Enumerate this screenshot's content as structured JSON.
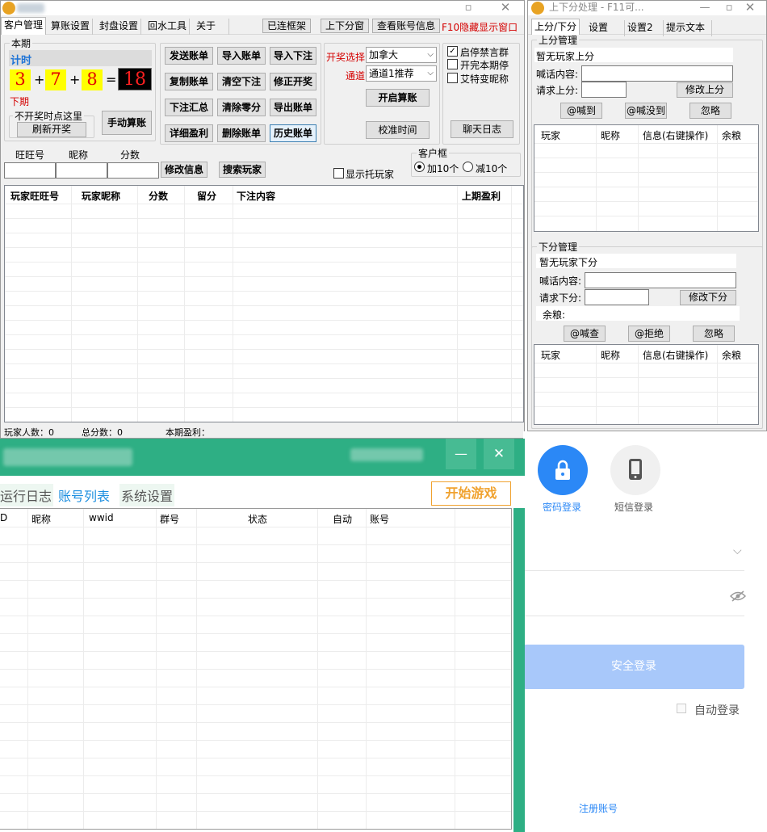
{
  "main": {
    "tabs": [
      "客户管理",
      "算账设置",
      "封盘设置",
      "回水工具",
      "关于"
    ],
    "toolbar": {
      "btn1": "已连框架",
      "btn2": "上下分窗",
      "btn3": "查看账号信息",
      "hint": "F10隐藏显示窗口"
    },
    "period": {
      "legend": "本期",
      "timer_label": "计时",
      "next_label": "下期",
      "digits": [
        "3",
        "7",
        "8"
      ],
      "plus": "+",
      "equals": "=",
      "result": "18",
      "no_draw_hint": "不开奖时点这里",
      "refresh_button": "刷新开奖",
      "manual_button": "手动算账"
    },
    "buttons": {
      "send": "发送账单",
      "import_bill": "导入账单",
      "import_bet": "导入下注",
      "copy": "复制账单",
      "clear_bet": "清空下注",
      "fix_draw": "修正开奖",
      "bet_summary": "下注汇总",
      "clear_zero": "清除零分",
      "export": "导出账单",
      "detail_profit": "详细盈利",
      "delete_bill": "删除账单",
      "history": "历史账单"
    },
    "draw": {
      "select_label": "开奖选择",
      "select_value": "加拿大",
      "channel_label": "通道",
      "channel_value": "通道1推荐",
      "start_button": "开启算账",
      "calibrate_button": "校准时间"
    },
    "options": {
      "ban_group": "启停禁言群",
      "stop_after": "开完本期停",
      "at_nick": "艾特变昵称",
      "chat_log_button": "聊天日志"
    },
    "inputs": {
      "wangwang_label": "旺旺号",
      "nick_label": "昵称",
      "score_label": "分数",
      "modify_button": "修改信息",
      "search_button": "搜索玩家",
      "show_proxy": "显示托玩家"
    },
    "client_box": {
      "legend": "客户框",
      "add": "加10个",
      "sub": "减10个"
    },
    "table": {
      "headers": [
        "玩家旺旺号",
        "玩家昵称",
        "分数",
        "留分",
        "下注内容",
        "上期盈利"
      ]
    },
    "status": {
      "players": "玩家人数：0",
      "total": "总分数：0",
      "profit": "本期盈利："
    }
  },
  "side": {
    "title": "上下分处理 - F11可...",
    "tabs": [
      "上分/下分",
      "设置",
      "设置2",
      "提示文本"
    ],
    "up": {
      "legend": "上分管理",
      "empty": "暂无玩家上分",
      "shout_label": "喊话内容:",
      "request_label": "请求上分:",
      "modify_button": "修改上分",
      "btn_arrived": "@喊到",
      "btn_missing": "@喊没到",
      "btn_ignore": "忽略"
    },
    "up_table": {
      "headers": [
        "玩家",
        "昵称",
        "信息(右键操作)",
        "余粮"
      ]
    },
    "down": {
      "legend": "下分管理",
      "empty": "暂无玩家下分",
      "shout_label": "喊话内容:",
      "request_label": "请求下分:",
      "modify_button": "修改下分",
      "balance_label": "余粮:",
      "btn_check": "@喊查",
      "btn_reject": "@拒绝",
      "btn_ignore": "忽略"
    },
    "down_table": {
      "headers": [
        "玩家",
        "昵称",
        "信息(右键操作)",
        "余粮"
      ]
    }
  },
  "green": {
    "tabs": [
      "运行日志",
      "账号列表",
      "系统设置"
    ],
    "start_button": "开始游戏",
    "table": {
      "headers": [
        "D",
        "昵称",
        "wwid",
        "群号",
        "状态",
        "自动",
        "账号"
      ]
    },
    "minimize": "—",
    "close": "✕"
  },
  "login": {
    "password_login": "密码登录",
    "sms_login": "短信登录",
    "submit": "安全登录",
    "auto_login": "自动登录",
    "register": "注册账号",
    "accent": "#2b88f6",
    "submit_color": "#a8c8fa"
  }
}
